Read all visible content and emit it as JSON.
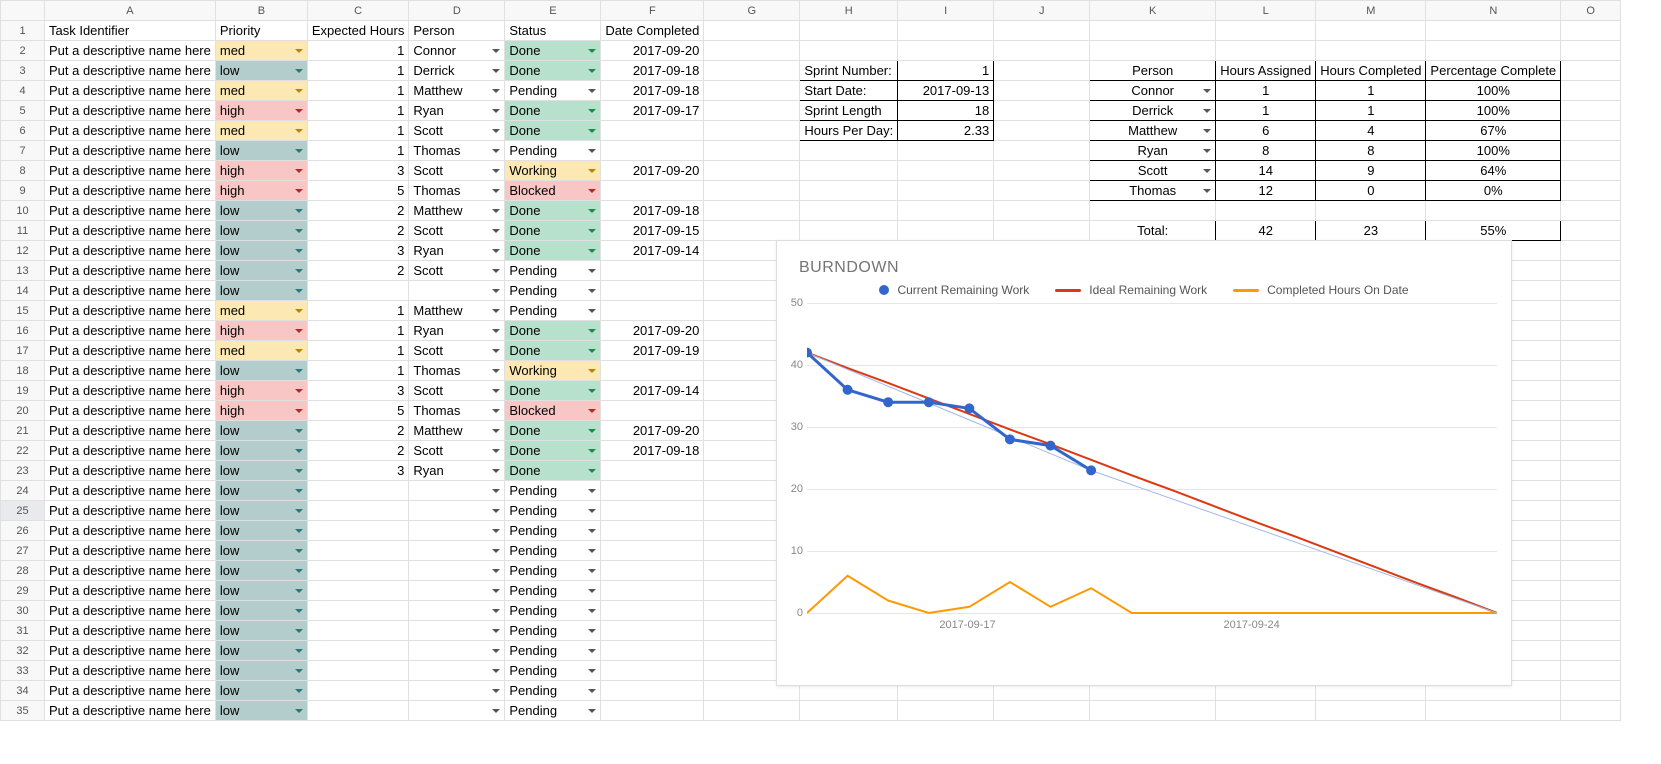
{
  "columns": [
    "A",
    "B",
    "C",
    "D",
    "E",
    "F",
    "G",
    "H",
    "I",
    "J",
    "K",
    "L",
    "M",
    "N",
    "O"
  ],
  "headers": {
    "A": "Task Identifier",
    "B": "Priority",
    "C": "Expected Hours",
    "D": "Person",
    "E": "Status",
    "F": "Date Completed"
  },
  "tasks": [
    {
      "name": "Put a descriptive name here",
      "priority": "med",
      "hours": "1",
      "person": "Connor",
      "status": "Done",
      "date": "2017-09-20"
    },
    {
      "name": "Put a descriptive name here",
      "priority": "low",
      "hours": "1",
      "person": "Derrick",
      "status": "Done",
      "date": "2017-09-18"
    },
    {
      "name": "Put a descriptive name here",
      "priority": "med",
      "hours": "1",
      "person": "Matthew",
      "status": "Pending",
      "date": "2017-09-18"
    },
    {
      "name": "Put a descriptive name here",
      "priority": "high",
      "hours": "1",
      "person": "Ryan",
      "status": "Done",
      "date": "2017-09-17"
    },
    {
      "name": "Put a descriptive name here",
      "priority": "med",
      "hours": "1",
      "person": "Scott",
      "status": "Done",
      "date": ""
    },
    {
      "name": "Put a descriptive name here",
      "priority": "low",
      "hours": "1",
      "person": "Thomas",
      "status": "Pending",
      "date": ""
    },
    {
      "name": "Put a descriptive name here",
      "priority": "high",
      "hours": "3",
      "person": "Scott",
      "status": "Working",
      "date": "2017-09-20"
    },
    {
      "name": "Put a descriptive name here",
      "priority": "high",
      "hours": "5",
      "person": "Thomas",
      "status": "Blocked",
      "date": ""
    },
    {
      "name": "Put a descriptive name here",
      "priority": "low",
      "hours": "2",
      "person": "Matthew",
      "status": "Done",
      "date": "2017-09-18"
    },
    {
      "name": "Put a descriptive name here",
      "priority": "low",
      "hours": "2",
      "person": "Scott",
      "status": "Done",
      "date": "2017-09-15"
    },
    {
      "name": "Put a descriptive name here",
      "priority": "low",
      "hours": "3",
      "person": "Ryan",
      "status": "Done",
      "date": "2017-09-14"
    },
    {
      "name": "Put a descriptive name here",
      "priority": "low",
      "hours": "2",
      "person": "Scott",
      "status": "Pending",
      "date": ""
    },
    {
      "name": "Put a descriptive name here",
      "priority": "low",
      "hours": "",
      "person": "",
      "status": "Pending",
      "date": ""
    },
    {
      "name": "Put a descriptive name here",
      "priority": "med",
      "hours": "1",
      "person": "Matthew",
      "status": "Pending",
      "date": ""
    },
    {
      "name": "Put a descriptive name here",
      "priority": "high",
      "hours": "1",
      "person": "Ryan",
      "status": "Done",
      "date": "2017-09-20"
    },
    {
      "name": "Put a descriptive name here",
      "priority": "med",
      "hours": "1",
      "person": "Scott",
      "status": "Done",
      "date": "2017-09-19"
    },
    {
      "name": "Put a descriptive name here",
      "priority": "low",
      "hours": "1",
      "person": "Thomas",
      "status": "Working",
      "date": ""
    },
    {
      "name": "Put a descriptive name here",
      "priority": "high",
      "hours": "3",
      "person": "Scott",
      "status": "Done",
      "date": "2017-09-14"
    },
    {
      "name": "Put a descriptive name here",
      "priority": "high",
      "hours": "5",
      "person": "Thomas",
      "status": "Blocked",
      "date": ""
    },
    {
      "name": "Put a descriptive name here",
      "priority": "low",
      "hours": "2",
      "person": "Matthew",
      "status": "Done",
      "date": "2017-09-20"
    },
    {
      "name": "Put a descriptive name here",
      "priority": "low",
      "hours": "2",
      "person": "Scott",
      "status": "Done",
      "date": "2017-09-18"
    },
    {
      "name": "Put a descriptive name here",
      "priority": "low",
      "hours": "3",
      "person": "Ryan",
      "status": "Done",
      "date": ""
    },
    {
      "name": "Put a descriptive name here",
      "priority": "low",
      "hours": "",
      "person": "",
      "status": "Pending",
      "date": ""
    },
    {
      "name": "Put a descriptive name here",
      "priority": "low",
      "hours": "",
      "person": "",
      "status": "Pending",
      "date": ""
    },
    {
      "name": "Put a descriptive name here",
      "priority": "low",
      "hours": "",
      "person": "",
      "status": "Pending",
      "date": ""
    },
    {
      "name": "Put a descriptive name here",
      "priority": "low",
      "hours": "",
      "person": "",
      "status": "Pending",
      "date": ""
    },
    {
      "name": "Put a descriptive name here",
      "priority": "low",
      "hours": "",
      "person": "",
      "status": "Pending",
      "date": ""
    },
    {
      "name": "Put a descriptive name here",
      "priority": "low",
      "hours": "",
      "person": "",
      "status": "Pending",
      "date": ""
    },
    {
      "name": "Put a descriptive name here",
      "priority": "low",
      "hours": "",
      "person": "",
      "status": "Pending",
      "date": ""
    },
    {
      "name": "Put a descriptive name here",
      "priority": "low",
      "hours": "",
      "person": "",
      "status": "Pending",
      "date": ""
    },
    {
      "name": "Put a descriptive name here",
      "priority": "low",
      "hours": "",
      "person": "",
      "status": "Pending",
      "date": ""
    },
    {
      "name": "Put a descriptive name here",
      "priority": "low",
      "hours": "",
      "person": "",
      "status": "Pending",
      "date": ""
    },
    {
      "name": "Put a descriptive name here",
      "priority": "low",
      "hours": "",
      "person": "",
      "status": "Pending",
      "date": ""
    },
    {
      "name": "Put a descriptive name here",
      "priority": "low",
      "hours": "",
      "person": "",
      "status": "Pending",
      "date": ""
    }
  ],
  "sprint": {
    "labels": {
      "number": "Sprint Number:",
      "start": "Start Date:",
      "length": "Sprint Length",
      "hpd": "Hours Per Day:"
    },
    "values": {
      "number": "1",
      "start": "2017-09-13",
      "length": "18",
      "hpd": "2.33"
    }
  },
  "people_table": {
    "headers": {
      "person": "Person",
      "assigned": "Hours Assigned",
      "completed": "Hours Completed",
      "pct": "Percentage Complete"
    },
    "rows": [
      {
        "person": "Connor",
        "assigned": "1",
        "completed": "1",
        "pct": "100%"
      },
      {
        "person": "Derrick",
        "assigned": "1",
        "completed": "1",
        "pct": "100%"
      },
      {
        "person": "Matthew",
        "assigned": "6",
        "completed": "4",
        "pct": "67%"
      },
      {
        "person": "Ryan",
        "assigned": "8",
        "completed": "8",
        "pct": "100%"
      },
      {
        "person": "Scott",
        "assigned": "14",
        "completed": "9",
        "pct": "64%"
      },
      {
        "person": "Thomas",
        "assigned": "12",
        "completed": "0",
        "pct": "0%"
      }
    ],
    "total": {
      "label": "Total:",
      "assigned": "42",
      "completed": "23",
      "pct": "55%"
    }
  },
  "chart_data": {
    "type": "line",
    "title": "BURNDOWN",
    "legend": [
      "Current Remaining Work",
      "Ideal Remaining Work",
      "Completed Hours On Date"
    ],
    "colors": {
      "current": "#3366cc",
      "ideal": "#dc3912",
      "completed": "#ff9900"
    },
    "ylim": [
      0,
      50
    ],
    "yticks": [
      0,
      10,
      20,
      30,
      40,
      50
    ],
    "xticks": [
      "2017-09-17",
      "2017-09-24"
    ],
    "x_categories": [
      "2017-09-13",
      "2017-09-14",
      "2017-09-15",
      "2017-09-16",
      "2017-09-17",
      "2017-09-18",
      "2017-09-19",
      "2017-09-20",
      "2017-09-21",
      "2017-09-22",
      "2017-09-23",
      "2017-09-24",
      "2017-09-25",
      "2017-09-26",
      "2017-09-27",
      "2017-09-28",
      "2017-09-29",
      "2017-09-30"
    ],
    "series": [
      {
        "name": "Current Remaining Work",
        "values": [
          42,
          36,
          34,
          34,
          33,
          28,
          27,
          23,
          null,
          null,
          null,
          null,
          null,
          null,
          null,
          null,
          null,
          null
        ]
      },
      {
        "name": "Ideal Remaining Work",
        "values": [
          42,
          39.5,
          37.1,
          34.6,
          32.1,
          29.6,
          27.2,
          24.7,
          22.2,
          19.8,
          17.3,
          14.8,
          12.4,
          9.9,
          7.4,
          4.9,
          2.5,
          0
        ]
      },
      {
        "name": "Completed Hours On Date",
        "values": [
          0,
          6,
          2,
          0,
          1,
          5,
          1,
          4,
          0,
          0,
          0,
          0,
          0,
          0,
          0,
          0,
          0,
          0
        ]
      }
    ]
  }
}
